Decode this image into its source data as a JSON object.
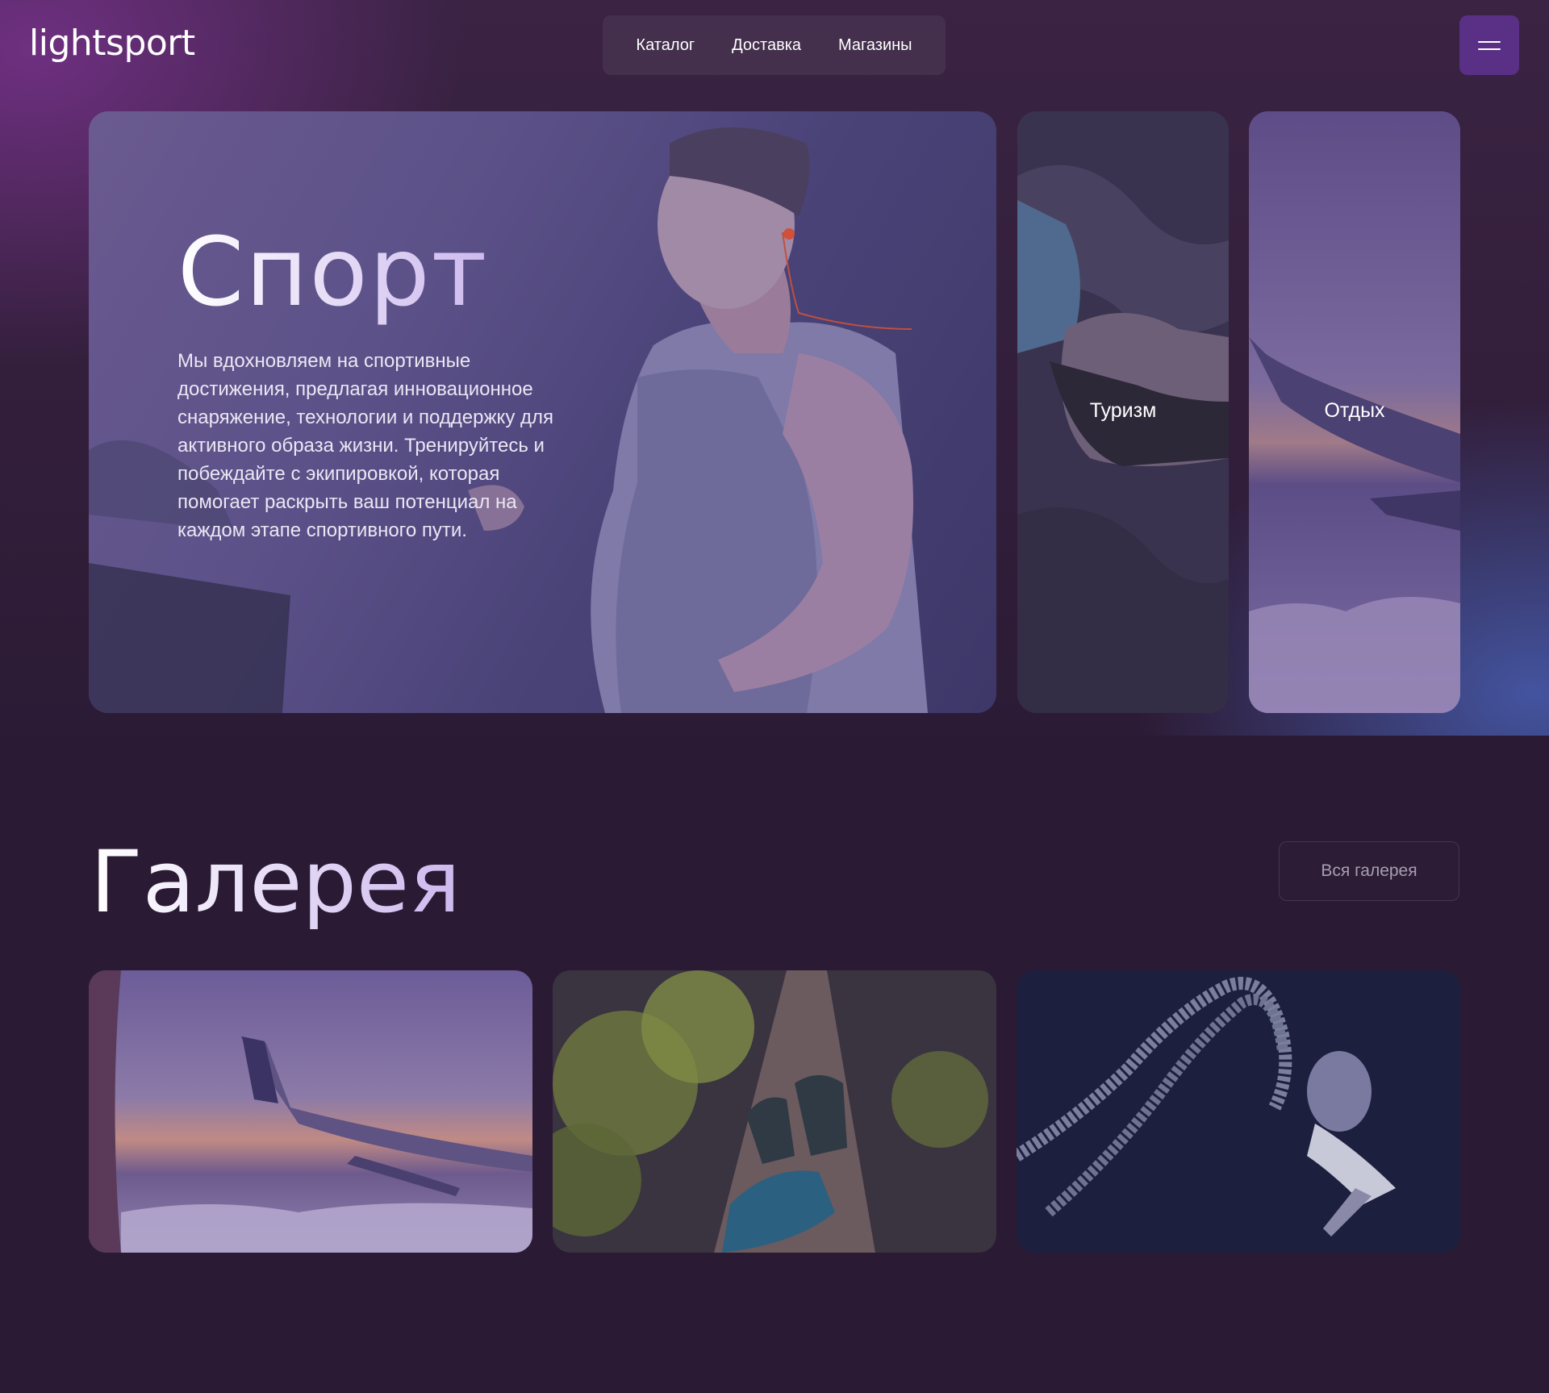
{
  "header": {
    "logo": "lightsport",
    "nav": [
      "Каталог",
      "Доставка",
      "Магазины"
    ]
  },
  "hero": {
    "title": "Спорт",
    "text": "Мы вдохновляем на спортивные достижения, предлагая инновационное снаряжение, технологии и поддержку для активного образа жизни. Тренируйтесь и побеждайте с экипировкой, которая помогает раскрыть ваш потенциал на каждом этапе спортивного пути."
  },
  "side_cards": [
    {
      "label": "Туризм"
    },
    {
      "label": "Отдых"
    }
  ],
  "gallery": {
    "title": "Галерея",
    "all_button": "Вся галерея"
  },
  "colors": {
    "background": "#2a1a33",
    "accent_button": "#5a2f86",
    "title_gradient_end": "#cdb9ee"
  },
  "icons": [
    "menu-icon"
  ]
}
